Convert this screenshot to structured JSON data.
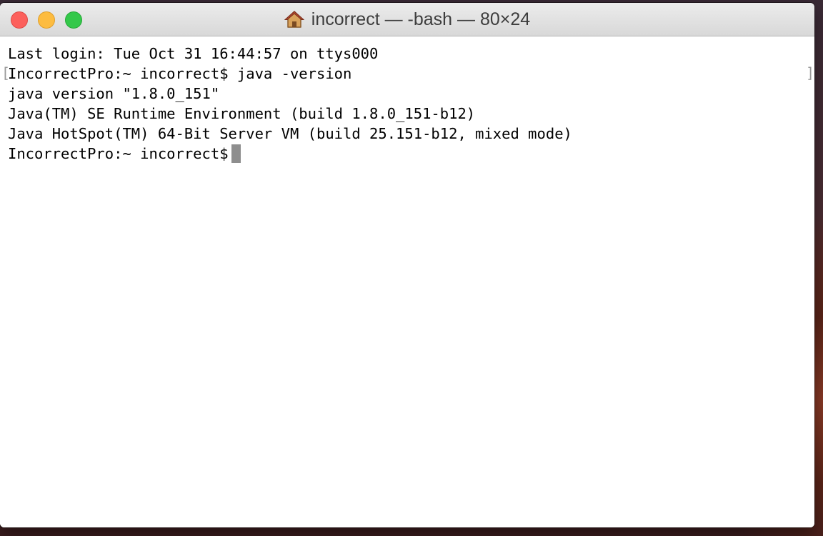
{
  "window": {
    "title": "incorrect — -bash — 80×24",
    "title_icon": "home-icon"
  },
  "traffic_lights": {
    "close_color": "#fc605c",
    "minimize_color": "#fdbc40",
    "zoom_color": "#34c84a"
  },
  "terminal": {
    "lines": [
      "Last login: Tue Oct 31 16:44:57 on ttys000",
      "IncorrectPro:~ incorrect$ java -version",
      "java version \"1.8.0_151\"",
      "Java(TM) SE Runtime Environment (build 1.8.0_151-b12)",
      "Java HotSpot(TM) 64-Bit Server VM (build 25.151-b12, mixed mode)"
    ],
    "prompt": "IncorrectPro:~ incorrect$",
    "mark_left": "[",
    "mark_right": "]"
  }
}
